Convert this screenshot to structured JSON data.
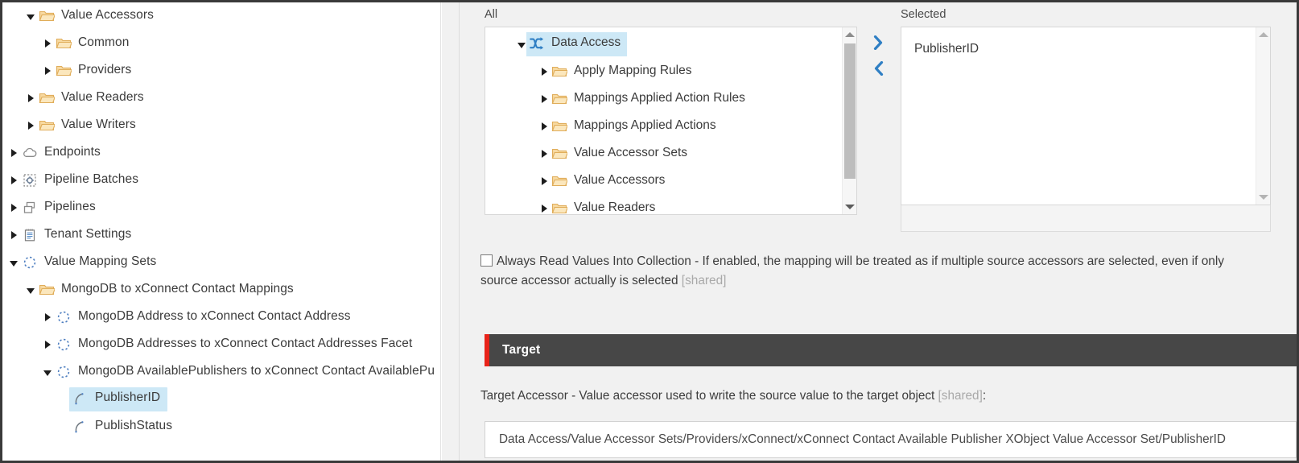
{
  "content_tree": {
    "items": [
      {
        "label": "Value Accessors",
        "icon": "folder-open-icon",
        "indent": 1,
        "twist": "down",
        "selected": false
      },
      {
        "label": "Common",
        "icon": "folder-open-icon",
        "indent": 2,
        "twist": "right",
        "selected": false
      },
      {
        "label": "Providers",
        "icon": "folder-open-icon",
        "indent": 2,
        "twist": "right",
        "selected": false
      },
      {
        "label": "Value Readers",
        "icon": "folder-open-icon",
        "indent": 1,
        "twist": "right",
        "selected": false
      },
      {
        "label": "Value Writers",
        "icon": "folder-open-icon",
        "indent": 1,
        "twist": "right",
        "selected": false
      },
      {
        "label": "Endpoints",
        "icon": "cloud-icon",
        "indent": 0,
        "twist": "right",
        "selected": false
      },
      {
        "label": "Pipeline Batches",
        "icon": "pipeline-batch-icon",
        "indent": 0,
        "twist": "right",
        "selected": false
      },
      {
        "label": "Pipelines",
        "icon": "pipelines-icon",
        "indent": 0,
        "twist": "right",
        "selected": false
      },
      {
        "label": "Tenant Settings",
        "icon": "notepad-icon",
        "indent": 0,
        "twist": "right",
        "selected": false
      },
      {
        "label": "Value Mapping Sets",
        "icon": "dotted-circle-icon",
        "indent": 0,
        "twist": "down",
        "selected": false
      },
      {
        "label": "MongoDB to xConnect Contact Mappings",
        "icon": "folder-open-icon",
        "indent": 1,
        "twist": "down",
        "selected": false
      },
      {
        "label": "MongoDB Address to xConnect Contact Address",
        "icon": "dotted-circle-icon",
        "indent": 2,
        "twist": "right",
        "selected": false
      },
      {
        "label": "MongoDB Addresses to xConnect Contact Addresses Facet",
        "icon": "dotted-circle-icon",
        "indent": 2,
        "twist": "right",
        "selected": false
      },
      {
        "label": "MongoDB AvailablePublishers to xConnect Contact AvailablePu",
        "icon": "dotted-circle-icon",
        "indent": 2,
        "twist": "down",
        "selected": false
      },
      {
        "label": "PublisherID",
        "icon": "mapping-arc-icon",
        "indent": 3,
        "twist": "none",
        "selected": true
      },
      {
        "label": "PublishStatus",
        "icon": "mapping-arc-icon",
        "indent": 3,
        "twist": "none",
        "selected": false
      }
    ]
  },
  "source_section": {
    "all_caption": "All",
    "selected_caption": "Selected",
    "all_items": [
      {
        "label": "Data Access",
        "icon": "data-access-icon",
        "indent": 0,
        "twist": "down",
        "selected": true
      },
      {
        "label": "Apply Mapping Rules",
        "icon": "folder-open-icon",
        "indent": 1,
        "twist": "right",
        "selected": false
      },
      {
        "label": "Mappings Applied Action Rules",
        "icon": "folder-open-icon",
        "indent": 1,
        "twist": "right",
        "selected": false
      },
      {
        "label": "Mappings Applied Actions",
        "icon": "folder-open-icon",
        "indent": 1,
        "twist": "right",
        "selected": false
      },
      {
        "label": "Value Accessor Sets",
        "icon": "folder-open-icon",
        "indent": 1,
        "twist": "right",
        "selected": false
      },
      {
        "label": "Value Accessors",
        "icon": "folder-open-icon",
        "indent": 1,
        "twist": "right",
        "selected": false
      },
      {
        "label": "Value Readers",
        "icon": "folder-open-icon",
        "indent": 1,
        "twist": "right",
        "selected": false
      }
    ],
    "selected_items": [
      "PublisherID"
    ],
    "add_button_icon": "chevron-right-icon",
    "remove_button_icon": "chevron-left-icon"
  },
  "always_read": {
    "checked": false,
    "text": "Always Read Values Into Collection - If enabled, the mapping will be treated as if multiple source accessors are selected, even if only",
    "text_line2": "source accessor actually is selected",
    "shared_tag": "[shared]"
  },
  "target_section": {
    "title": "Target",
    "accessor_label_main": "Target Accessor - Value accessor used to write the source value to the target object",
    "accessor_label_shared": "[shared]",
    "accessor_label_colon": ":",
    "accessor_value": "Data Access/Value Accessor Sets/Providers/xConnect/xConnect Contact Available Publisher XObject Value Accessor Set/PublisherID"
  },
  "colors": {
    "selection": "#cde8f6",
    "folder": "#f0c070",
    "accent_red": "#e8231a",
    "target_bar": "#474747",
    "link_blue": "#3382c4"
  }
}
